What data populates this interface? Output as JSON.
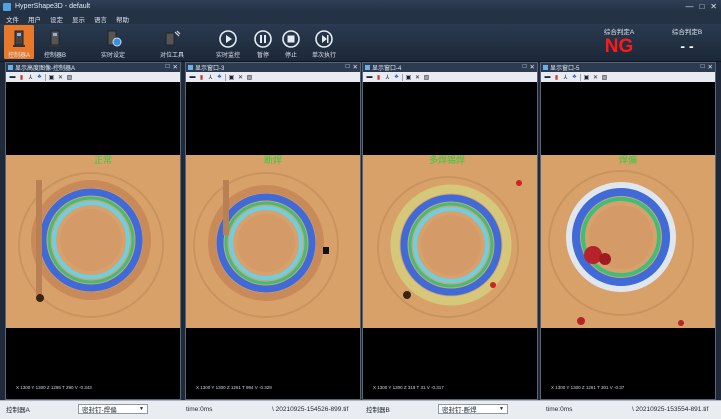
{
  "window": {
    "title": "HyperShape3D - default",
    "minimize": "—",
    "maximize": "□",
    "close": "✕"
  },
  "menu": [
    "文件",
    "用户",
    "设定",
    "显示",
    "语言",
    "帮助"
  ],
  "toolbar": {
    "buttons": [
      {
        "label": "控制器A",
        "icon": "controller-icon",
        "active": true
      },
      {
        "label": "控制器B",
        "icon": "controller-icon",
        "active": false
      },
      {
        "label": "实时设定",
        "icon": "settings-sync-icon",
        "active": false
      },
      {
        "label": "对位工具",
        "icon": "align-tool-icon",
        "active": false
      },
      {
        "label": "实时监控",
        "icon": "play-icon",
        "active": false
      },
      {
        "label": "暂停",
        "icon": "pause-icon",
        "active": false
      },
      {
        "label": "停止",
        "icon": "stop-icon",
        "active": false
      },
      {
        "label": "单次执行",
        "icon": "single-step-icon",
        "active": false
      }
    ],
    "verdict_a": {
      "label": "综合判定A",
      "value": "NG",
      "color": "#ff1a1a"
    },
    "verdict_b": {
      "label": "综合判定B",
      "value": "- -",
      "color": "#ffffff"
    }
  },
  "panels": [
    {
      "title": "显示高度图像-控制器A",
      "overlay": "正常",
      "status": "X 1300  Y 1300  Z 1295  T 290  V -0.343"
    },
    {
      "title": "显示窗口-3",
      "overlay": "断焊",
      "status": "X 1300  Y 1300  Z 1261  T 994  V -0.329"
    },
    {
      "title": "显示窗口-4",
      "overlay": "多焊锡焊",
      "status": "X 1300  Y 1300  Z 319  T 31  V -0.317"
    },
    {
      "title": "显示窗口-5",
      "overlay": "焊偏",
      "status": "X 1300  Y 1300  Z 1261  T 301  V -0.37"
    }
  ],
  "panel_tools": [
    "save-icon",
    "chart-icon",
    "axis-icon",
    "palette-icon",
    "disk-icon",
    "cross-icon",
    "image-icon"
  ],
  "statusbar": {
    "a_label": "控制器A",
    "a_select": "密封钉-焊偏",
    "a_time": "time:0ms",
    "a_file": "\\ 20210925-154526-899.tif",
    "b_label": "控制器B",
    "b_select": "密封钉-断焊",
    "b_time": "time:0ms",
    "b_file": "\\ 20210925-153554-891.tif"
  },
  "colors": {
    "accent": "#e8782a",
    "overlay_text": "#2ecc40",
    "background": "#1e2a3a"
  }
}
